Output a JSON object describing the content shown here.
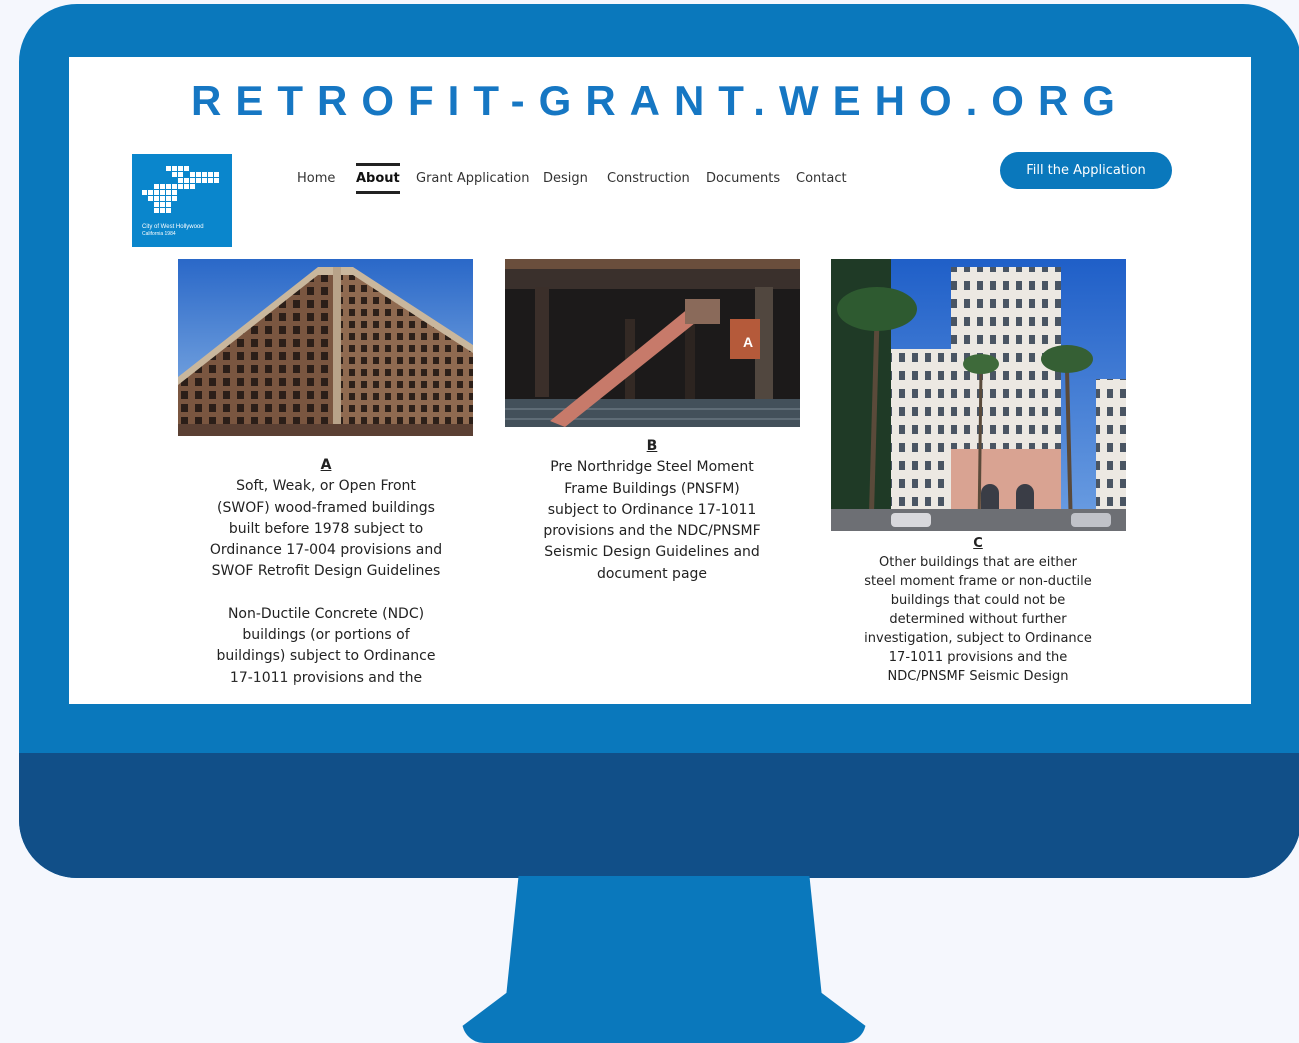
{
  "site_title": "RETROFIT-GRANT.WEHO.ORG",
  "logo": {
    "text_line1": "City of West Hollywood",
    "text_line2": "California 1984"
  },
  "nav": {
    "items": [
      "Home",
      "About",
      "Grant Application",
      "Design",
      "Construction",
      "Documents",
      "Contact"
    ],
    "active": "About"
  },
  "cta_label": "Fill the Application",
  "cards": [
    {
      "letter": "A",
      "image": "brick-highrise-building-photo",
      "text": "Soft, Weak, or Open Front (SWOF) wood-framed buildings built before 1978 subject to Ordinance 17-004 provisions and SWOF Retrofit Design Guidelines",
      "text2": "Non-Ductile Concrete (NDC) buildings (or portions of buildings) subject to Ordinance 17-1011 provisions and the"
    },
    {
      "letter": "B",
      "image": "steel-brace-construction-photo",
      "text": "Pre Northridge Steel Moment Frame Buildings (PNSFM) subject to Ordinance 17-1011 provisions and the NDC/PNSMF Seismic Design Guidelines and document page"
    },
    {
      "letter": "C",
      "image": "white-tower-palm-trees-photo",
      "text": "Other buildings that are either steel moment frame or non-ductile buildings that could not be determined without further investigation, subject to Ordinance 17-1011 provisions and the NDC/PNSMF Seismic Design"
    }
  ],
  "colors": {
    "frame": "#0a78bc",
    "chin": "#114f88",
    "title": "#1677c3"
  }
}
